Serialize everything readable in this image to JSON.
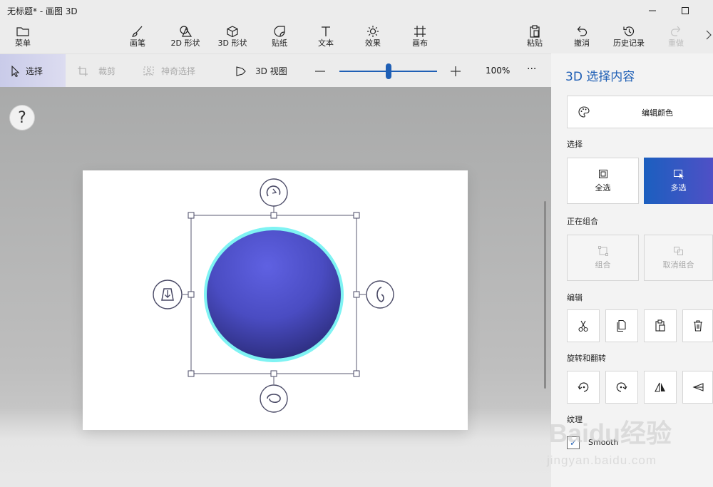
{
  "app": {
    "title": "无标题* - 画图 3D"
  },
  "window": {
    "minimize_icon": "minimize-icon",
    "maximize_icon": "maximize-icon"
  },
  "toolbar": {
    "menu": "菜单",
    "brushes": "画笔",
    "shapes2d": "2D 形状",
    "shapes3d": "3D 形状",
    "stickers": "贴纸",
    "text": "文本",
    "effects": "效果",
    "canvas": "画布",
    "paste": "粘贴",
    "undo": "撤消",
    "history": "历史记录",
    "redo": "重做"
  },
  "subbar": {
    "select": "选择",
    "crop": "裁剪",
    "magic_select": "神奇选择",
    "view3d": "3D 视图",
    "zoom_label": "100%",
    "zoom_level": 0.5,
    "more": "···"
  },
  "panel": {
    "title": "3D 选择内容",
    "edit_color": "编辑颜色",
    "selection_header": "选择",
    "select_all": "全选",
    "multi_select": "多选",
    "grouping_header": "正在组合",
    "group": "组合",
    "ungroup": "取消组合",
    "edit_header": "编辑",
    "rotate_header": "旋转和翻转",
    "texture_header": "纹理",
    "smooth": "Smooth",
    "smooth_checked": true
  },
  "watermark": {
    "brand": "Baidu经验",
    "url": "jingyan.baidu.com"
  },
  "colors": {
    "accent": "#1f5fb5",
    "sphere": "#4d4fc4",
    "halo": "#7ff3f3"
  }
}
